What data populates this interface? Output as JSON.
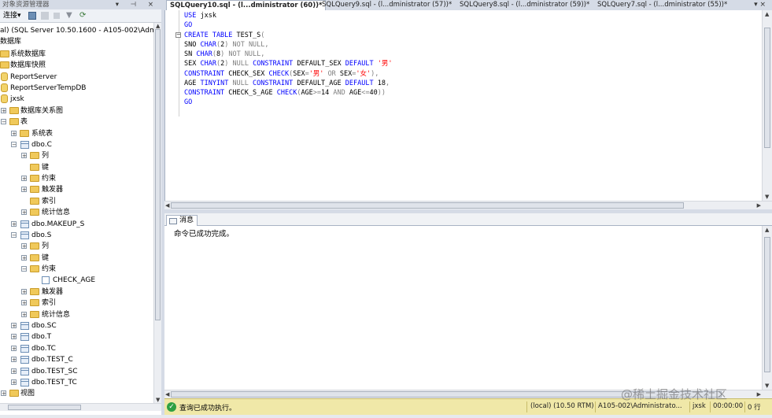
{
  "object_explorer": {
    "title": "对象资源管理器",
    "title_controls": "▾ ⊣ ×",
    "connect_label": "连接▾",
    "tree": {
      "server": "al) (SQL Server 10.50.1600 - A105-002\\Admini",
      "databases": "数据库",
      "system_databases": "系统数据库",
      "db_snapshots": "数据库快照",
      "report_server": "ReportServer",
      "report_server_temp": "ReportServerTempDB",
      "jxsk": "jxsk",
      "db_diagrams": "数据库关系图",
      "tables": "表",
      "system_tables": "系统表",
      "dbo_c": "dbo.C",
      "columns": "列",
      "keys": "键",
      "constraints": "约束",
      "triggers": "触发器",
      "indexes": "索引",
      "statistics": "统计信息",
      "dbo_makeup_s": "dbo.MAKEUP_S",
      "dbo_s": "dbo.S",
      "check_age": "CHECK_AGE",
      "dbo_sc": "dbo.SC",
      "dbo_t": "dbo.T",
      "dbo_tc": "dbo.TC",
      "dbo_test_c": "dbo.TEST_C",
      "dbo_test_sc": "dbo.TEST_SC",
      "dbo_test_tc": "dbo.TEST_TC",
      "views": "视图"
    }
  },
  "tabs": [
    {
      "label": "SQLQuery10.sql - (l...dministrator (60))*",
      "active": true
    },
    {
      "label": "SQLQuery9.sql - (l...dministrator (57))*",
      "active": false
    },
    {
      "label": "SQLQuery8.sql - (l...dministrator (59))*",
      "active": false
    },
    {
      "label": "SQLQuery7.sql - (l...dministrator (55))*",
      "active": false
    }
  ],
  "tab_close": "▾ ×",
  "results": {
    "tab_label": "消息",
    "message": "命令已成功完成。"
  },
  "status": {
    "message": "查询已成功执行。",
    "server": "(local) (10.50 RTM)",
    "user": "A105-002\\Administrato...",
    "database": "jxsk",
    "time": "00:00:00",
    "rows": "0 行"
  },
  "watermark": "@稀土掘金技术社区",
  "colors": {
    "keyword": "#0000ff",
    "string": "#ff0000",
    "comment_gray": "#808080",
    "status_bg": "#f0e8a8"
  }
}
